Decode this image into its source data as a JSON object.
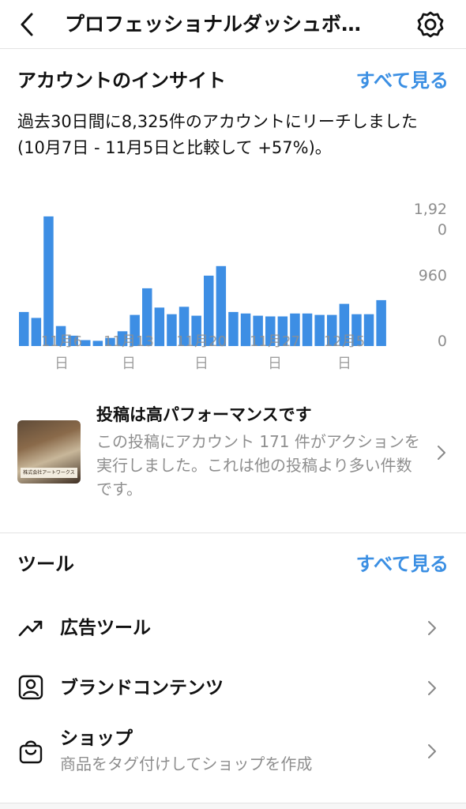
{
  "header": {
    "title": "プロフェッショナルダッシュボ…",
    "back_icon": "chevron-left-icon",
    "settings_icon": "gear-icon"
  },
  "insights": {
    "title": "アカウントのインサイト",
    "see_all": "すべて見る",
    "reach_text": "過去30日間に8,325件のアカウントにリーチしました (10月7日 - 11月5日と比較して +57%)。"
  },
  "chart_data": {
    "type": "bar",
    "values": [
      460,
      380,
      1750,
      270,
      140,
      80,
      70,
      110,
      200,
      420,
      780,
      520,
      430,
      530,
      410,
      950,
      1080,
      460,
      440,
      410,
      400,
      400,
      440,
      440,
      420,
      420,
      570,
      430,
      430,
      620
    ],
    "x_tick_labels": [
      {
        "line1": "11月6",
        "line2": "日"
      },
      {
        "line1": "11月13",
        "line2": "日"
      },
      {
        "line1": "11月20",
        "line2": "日"
      },
      {
        "line1": "11月27",
        "line2": "日"
      },
      {
        "line1": "12月5",
        "line2": "日"
      }
    ],
    "y_tick_labels": [
      "1,920",
      "960",
      "0"
    ],
    "ylim": [
      0,
      1920
    ],
    "bar_color": "#3d8ee4",
    "grid": false
  },
  "post_card": {
    "title": "投稿は高パフォーマンスです",
    "description": "この投稿にアカウント 171 件がアクションを実行しました。これは他の投稿より多い件数です。",
    "thumb_caption": "株式会社アートワークス"
  },
  "tools": {
    "title": "ツール",
    "see_all": "すべて見る",
    "items": [
      {
        "label": "広告ツール",
        "sub": "",
        "icon": "trending-up-icon"
      },
      {
        "label": "ブランドコンテンツ",
        "sub": "",
        "icon": "person-badge-icon"
      },
      {
        "label": "ショップ",
        "sub": "商品をタグ付けしてショップを作成",
        "icon": "shopping-bag-icon"
      }
    ]
  },
  "colors": {
    "accent": "#3b8fe3",
    "muted_text": "#8e8e8e",
    "divider": "#e3e3e3"
  }
}
